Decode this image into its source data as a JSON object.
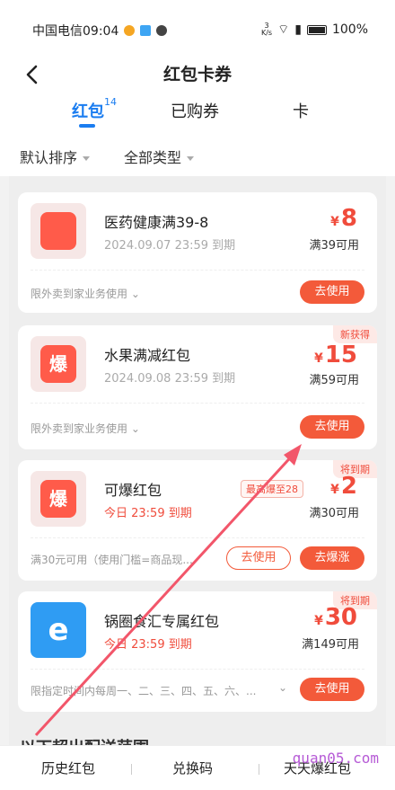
{
  "statusbar": {
    "carrier_time": "中国电信09:04",
    "speed_top": "3",
    "speed_bottom": "K/s",
    "battery": "100%"
  },
  "header": {
    "title": "红包卡券",
    "back_icon": "chevron-left-icon"
  },
  "tabs": [
    {
      "label": "红包",
      "count": "14",
      "active": true
    },
    {
      "label": "已购券"
    },
    {
      "label": "卡"
    }
  ],
  "filters": {
    "sort": "默认排序",
    "type": "全部类型"
  },
  "cards": [
    {
      "title": "医药健康满39-8",
      "date": "2024.09.07 23:59 到期",
      "amount": "8",
      "yen": "¥",
      "condition": "满39可用",
      "scope": "限外卖到家业务使用",
      "button": "去使用"
    },
    {
      "badge": "新获得",
      "title": "水果满减红包",
      "date": "2024.09.08 23:59 到期",
      "amount": "15",
      "yen": "¥",
      "condition": "满59可用",
      "scope": "限外卖到家业务使用",
      "button": "去使用",
      "thumb_text": "爆"
    },
    {
      "badge": "将到期",
      "title": "可爆红包",
      "date": "今日 23:59 到期",
      "tip": "最高爆至28",
      "amount": "2",
      "yen": "¥",
      "condition": "满30可用",
      "scope": "满30元可用（使用门槛=商品现...",
      "button_outline": "去使用",
      "button": "去爆涨",
      "thumb_text": "爆"
    },
    {
      "badge": "将到期",
      "title": "锅圈食汇专属红包",
      "date": "今日 23:59 到期",
      "amount": "30",
      "yen": "¥",
      "condition": "满149可用",
      "scope": "限指定时间内每周一、二、三、四、五、六、...",
      "button": "去使用",
      "thumb_text": "e"
    }
  ],
  "section_label": "以下超出配送范围",
  "bottombar": {
    "history": "历史红包",
    "redeem": "兑换码",
    "daily": "天天爆红包"
  },
  "watermark": "quan05.com",
  "colors": {
    "accent": "#1b7df0",
    "red": "#f04c3c",
    "button": "#f35a3a"
  }
}
